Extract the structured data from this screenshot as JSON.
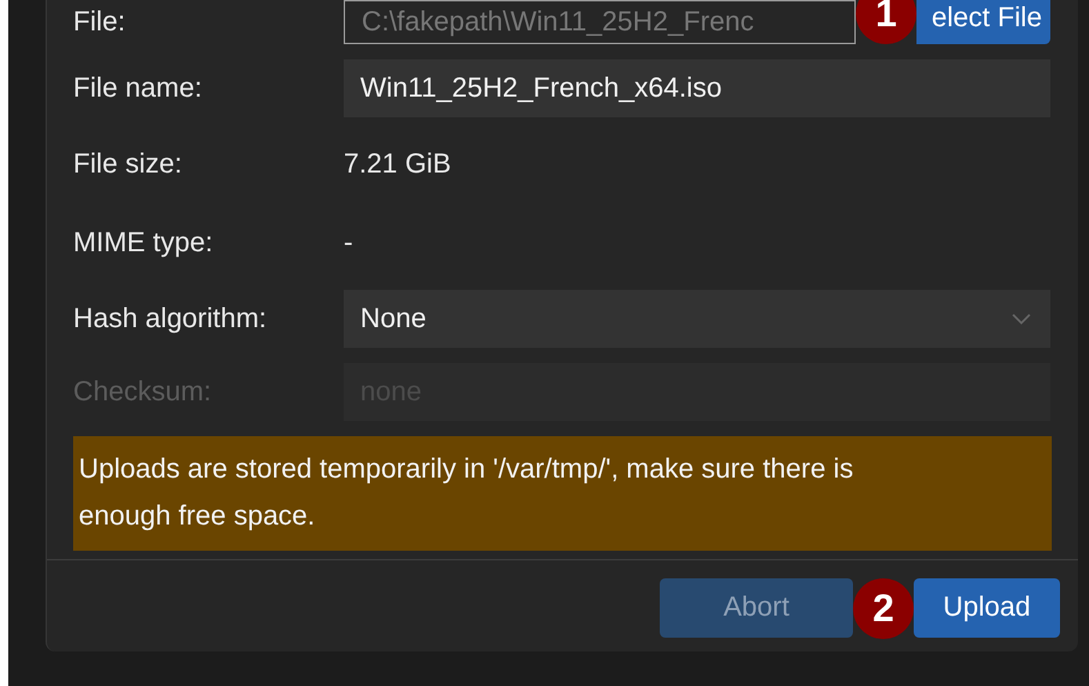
{
  "rows": [
    {
      "kind": "file",
      "label": "File:",
      "value": "C:\\fakepath\\Win11_25H2_Frenc",
      "button": "elect File",
      "badge": "1"
    },
    {
      "kind": "input",
      "label": "File name:",
      "value": "Win11_25H2_French_x64.iso",
      "disabled": false
    },
    {
      "kind": "text",
      "label": "File size:",
      "value": "7.21 GiB"
    },
    {
      "kind": "text",
      "label": "MIME type:",
      "value": "-"
    },
    {
      "kind": "select",
      "label": "Hash algorithm:",
      "value": "None",
      "disabled": false
    },
    {
      "kind": "input",
      "label": "Checksum:",
      "placeholder": "none",
      "disabled": true
    }
  ],
  "warning": "Uploads are stored temporarily in '/var/tmp/', make sure there is enough free space.",
  "buttons": [
    {
      "label": "Abort",
      "disabled": true
    },
    {
      "label": "Upload",
      "disabled": false,
      "badge": "2"
    }
  ]
}
